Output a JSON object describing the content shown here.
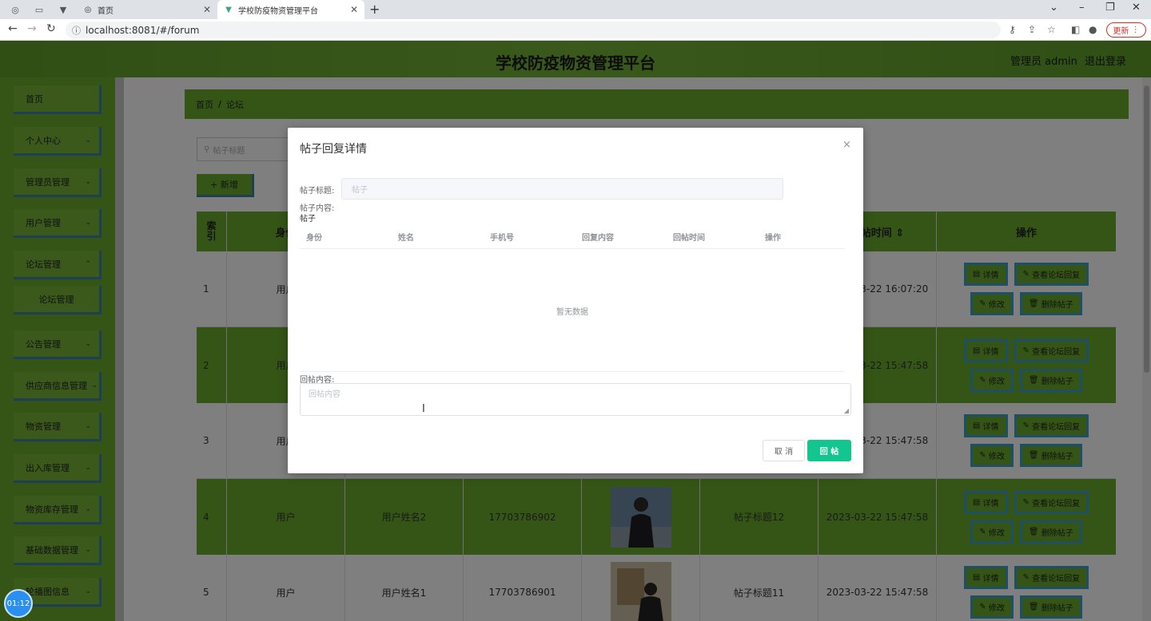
{
  "browser": {
    "tabs": [
      {
        "title": "首页",
        "active": false
      },
      {
        "title": "学校防疫物资管理平台",
        "active": true
      }
    ],
    "url": "localhost:8081/#/forum",
    "update_label": "更新",
    "new_tab": "+"
  },
  "header": {
    "title": "学校防疫物资管理平台",
    "user": "管理员 admin",
    "logout": "退出登录"
  },
  "sidebar": {
    "items": [
      {
        "label": "首页",
        "expandable": false
      },
      {
        "label": "个人中心",
        "expandable": true
      },
      {
        "label": "管理员管理",
        "expandable": true
      },
      {
        "label": "用户管理",
        "expandable": true
      },
      {
        "label": "论坛管理",
        "expandable": true
      },
      {
        "label": "论坛管理",
        "expandable": false
      },
      {
        "label": "公告管理",
        "expandable": true
      },
      {
        "label": "供应商信息管理",
        "expandable": true
      },
      {
        "label": "物资管理",
        "expandable": true
      },
      {
        "label": "出入库管理",
        "expandable": true
      },
      {
        "label": "物资库存管理",
        "expandable": true
      },
      {
        "label": "基础数据管理",
        "expandable": true
      },
      {
        "label": "轮播图信息",
        "expandable": true
      }
    ]
  },
  "breadcrumb": {
    "home": "首页",
    "sep": "/",
    "current": "论坛"
  },
  "search": {
    "placeholder": "帖子标题"
  },
  "toolbar": {
    "add_label": "+ 新增"
  },
  "table": {
    "headers": {
      "index": "索引",
      "identity": "身份",
      "time": "发帖时间 ⇕",
      "actions": "操作"
    },
    "rows": [
      {
        "index": "1",
        "identity": "用户",
        "name": "",
        "phone": "",
        "title": "",
        "time": "2023-03-22 16:07:20",
        "has_photo": false
      },
      {
        "index": "2",
        "identity": "用户",
        "name": "",
        "phone": "",
        "title": "",
        "time": "2023-03-22 15:47:58",
        "has_photo": false
      },
      {
        "index": "3",
        "identity": "用户",
        "name": "",
        "phone": "",
        "title": "",
        "time": "2023-03-22 15:47:58",
        "has_photo": false
      },
      {
        "index": "4",
        "identity": "用户",
        "name": "用户姓名2",
        "phone": "17703786902",
        "title": "帖子标题12",
        "time": "2023-03-22 15:47:58",
        "has_photo": true
      },
      {
        "index": "5",
        "identity": "用户",
        "name": "用户姓名1",
        "phone": "17703786901",
        "title": "帖子标题11",
        "time": "2023-03-22 15:47:58",
        "has_photo": true
      }
    ],
    "actions": {
      "detail": "详情",
      "view_replies": "查看论坛回复",
      "edit": "修改",
      "delete": "删除帖子"
    }
  },
  "dialog": {
    "title": "帖子回复详情",
    "close": "×",
    "post_title_label": "帖子标题:",
    "post_title_placeholder": "帖子",
    "post_content_label": "帖子内容:",
    "post_content_value": "帖子",
    "reply_table": {
      "headers": [
        "身份",
        "姓名",
        "手机号",
        "回复内容",
        "回帖时间",
        "操作"
      ],
      "empty_text": "暂无数据"
    },
    "reply_label": "回帖内容:",
    "reply_placeholder": "回帖内容",
    "cancel_label": "取 消",
    "submit_label": "回 帖"
  },
  "recorder": {
    "time": "01:12"
  }
}
